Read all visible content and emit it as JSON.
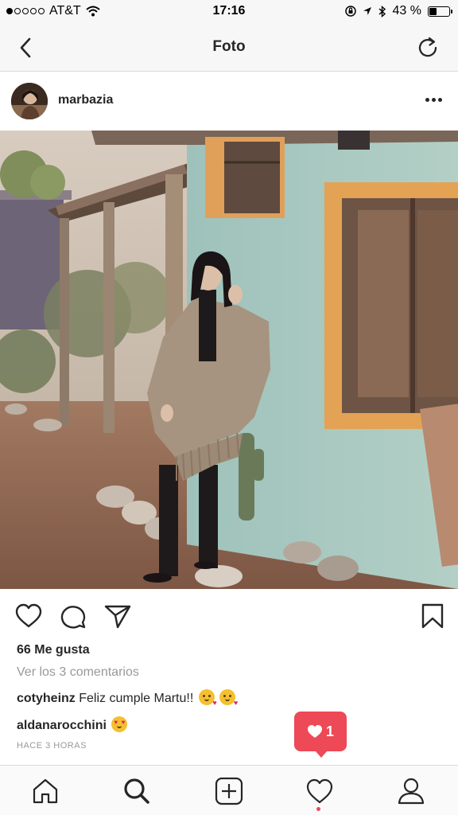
{
  "status_bar": {
    "carrier": "AT&T",
    "time": "17:16",
    "battery_text": "43 %",
    "battery_level": 0.43
  },
  "nav": {
    "title": "Foto",
    "back_icon": "chevron-left-icon",
    "refresh_icon": "refresh-icon"
  },
  "post": {
    "username": "marbazia",
    "more_icon": "more-horizontal-icon",
    "likes": "66 Me gusta",
    "view_comments": "Ver los 3 comentarios",
    "comments": [
      {
        "user": "cotyheinz",
        "text": "Feliz cumple Martu!!"
      },
      {
        "user": "aldanarocchini",
        "text": ""
      }
    ],
    "timestamp": "HACE 3 HORAS"
  },
  "notification": {
    "count": "1",
    "icon": "heart-icon",
    "color": "#ed4956"
  },
  "tabs": [
    "home-icon",
    "search-icon",
    "add-icon",
    "activity-heart-icon",
    "profile-icon"
  ],
  "colors": {
    "accent": "#ed4956",
    "text": "#262626",
    "muted": "#999999"
  }
}
